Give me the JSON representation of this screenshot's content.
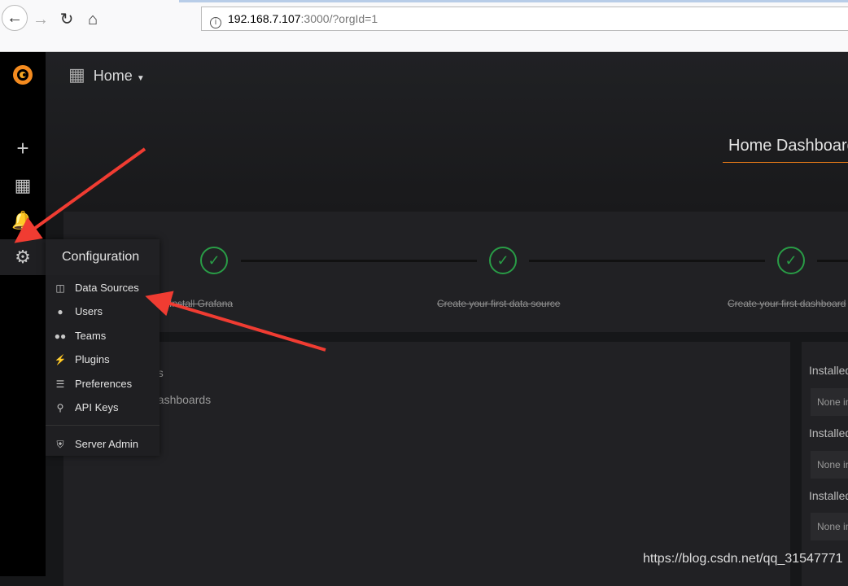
{
  "browser": {
    "url_host": "192.168.7.107",
    "url_rest": ":3000/?orgId=1"
  },
  "header": {
    "title": "Home",
    "dashboard_title": "Home Dashboard"
  },
  "steps": [
    {
      "label": "Install Grafana",
      "done": true
    },
    {
      "label": "Create your first data source",
      "done": true
    },
    {
      "label": "Create your first dashboard",
      "done": true
    }
  ],
  "left_panel": {
    "items": [
      "ds",
      "dashboards"
    ]
  },
  "right_panel": {
    "sections": [
      {
        "label": "Installed",
        "value": "None installed"
      },
      {
        "label": "Installed",
        "value": "None installed"
      },
      {
        "label": "Installed",
        "value": "None installed"
      }
    ]
  },
  "config_menu": {
    "title": "Configuration",
    "items": [
      {
        "label": "Data Sources",
        "icon": "database-icon"
      },
      {
        "label": "Users",
        "icon": "user-icon"
      },
      {
        "label": "Teams",
        "icon": "users-icon"
      },
      {
        "label": "Plugins",
        "icon": "plug-icon"
      },
      {
        "label": "Preferences",
        "icon": "sliders-icon"
      },
      {
        "label": "API Keys",
        "icon": "key-icon"
      }
    ],
    "footer": {
      "label": "Server Admin",
      "icon": "shield-icon"
    }
  },
  "watermark": "https://blog.csdn.net/qq_31547771",
  "colors": {
    "accent": "#eb7b18",
    "success": "#299c46",
    "annotation": "#f03c32"
  }
}
